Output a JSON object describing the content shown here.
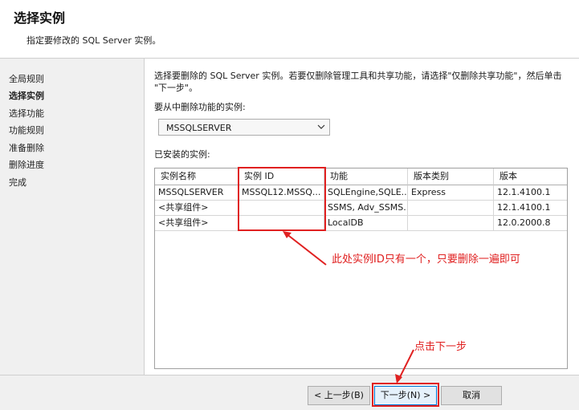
{
  "header": {
    "title": "选择实例",
    "subtitle": "指定要修改的 SQL Server 实例。"
  },
  "sidebar": {
    "items": [
      {
        "label": "全局规则",
        "active": false
      },
      {
        "label": "选择实例",
        "active": true
      },
      {
        "label": "选择功能",
        "active": false
      },
      {
        "label": "功能规则",
        "active": false
      },
      {
        "label": "准备删除",
        "active": false
      },
      {
        "label": "删除进度",
        "active": false
      },
      {
        "label": "完成",
        "active": false
      }
    ]
  },
  "main": {
    "description_line1": "选择要删除的 SQL Server 实例。若要仅删除管理工具和共享功能，请选择\"仅删除共享功能\"，然后单击",
    "description_line2": "\"下一步\"。",
    "select_label": "要从中删除功能的实例:",
    "instance_select_value": "MSSQLSERVER",
    "installed_label": "已安装的实例:",
    "table": {
      "headers": [
        "实例名称",
        "实例 ID",
        "功能",
        "版本类别",
        "版本"
      ],
      "rows": [
        [
          "MSSQLSERVER",
          "MSSQL12.MSSQ...",
          "SQLEngine,SQLE...",
          "Express",
          "12.1.4100.1"
        ],
        [
          "<共享组件>",
          "",
          "SSMS, Adv_SSMS...",
          "",
          "12.1.4100.1"
        ],
        [
          "<共享组件>",
          "",
          "LocalDB",
          "",
          "12.0.2000.8"
        ]
      ]
    }
  },
  "annotations": {
    "instance_note": "此处实例ID只有一个，只要删除一遍即可",
    "next_note": "点击下一步",
    "color": "#e02020"
  },
  "footer": {
    "back_label": "< 上一步(B)",
    "next_label": "下一步(N) >",
    "cancel_label": "取消"
  }
}
